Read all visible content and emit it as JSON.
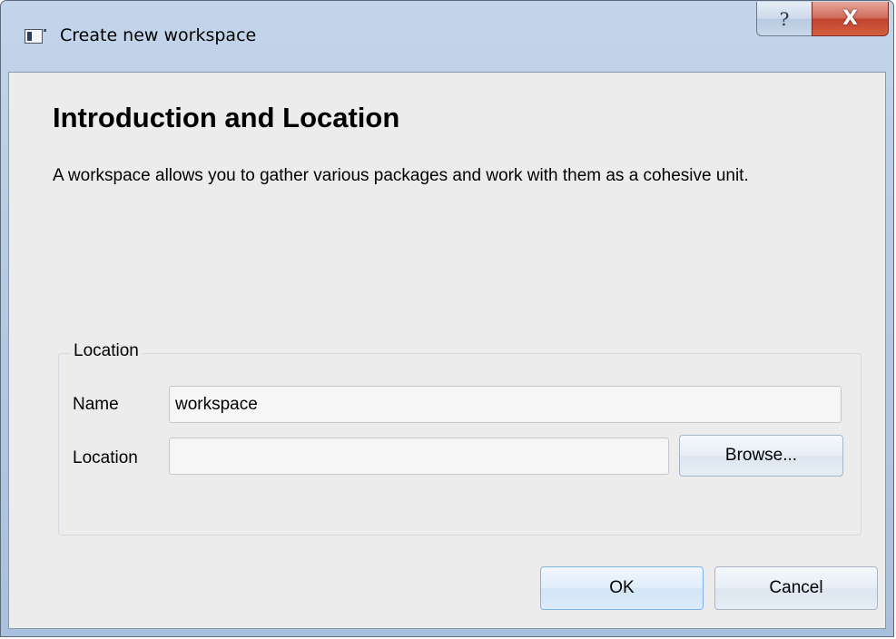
{
  "window": {
    "title": "Create new workspace",
    "help_glyph": "?",
    "close_glyph": "X"
  },
  "page": {
    "heading": "Introduction and Location",
    "description": "A workspace allows you to gather various packages and work with them as a cohesive unit."
  },
  "location_group": {
    "title": "Location",
    "name_label": "Name",
    "name_value": "workspace",
    "location_label": "Location",
    "location_value": "",
    "browse_label": "Browse..."
  },
  "footer": {
    "ok_label": "OK",
    "cancel_label": "Cancel"
  },
  "colors": {
    "titlebar": "#b6cbe4",
    "client_background": "#ececec",
    "close_button": "#c04330",
    "button_border_focus": "#7eb4ea"
  },
  "icons": {
    "app": "window-app-icon",
    "help": "help-icon",
    "close": "close-icon"
  }
}
